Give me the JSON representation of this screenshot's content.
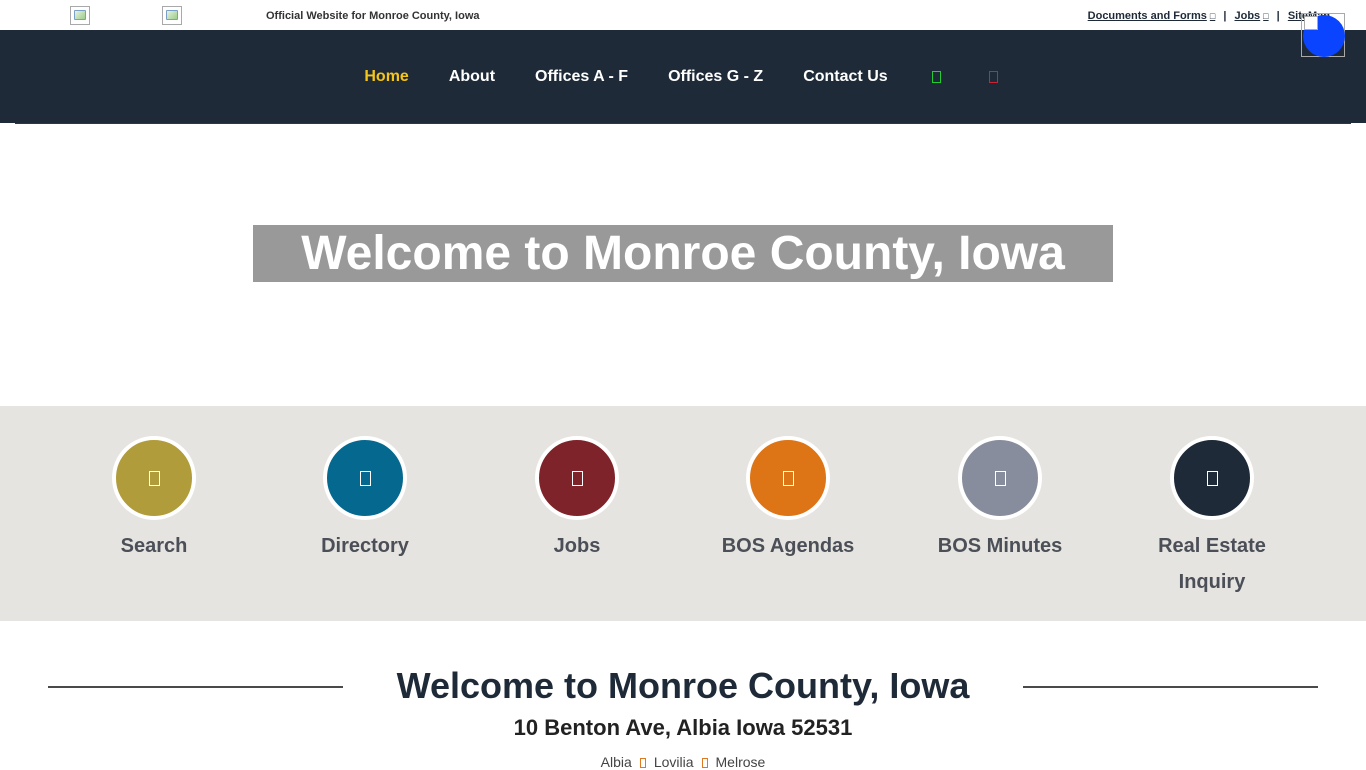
{
  "topbar": {
    "tagline": "Official Website for Monroe County, Iowa",
    "links": [
      {
        "label": "Documents and Forms"
      },
      {
        "label": "Jobs"
      },
      {
        "label": "SiteMap"
      }
    ],
    "separator": "|"
  },
  "nav": {
    "items": [
      {
        "label": "Home",
        "active": true
      },
      {
        "label": "About"
      },
      {
        "label": "Offices A - F"
      },
      {
        "label": "Offices G - Z"
      },
      {
        "label": "Contact Us"
      }
    ],
    "icons": [
      "green-square-icon",
      "red-square-icon"
    ]
  },
  "hero": {
    "title": "Welcome to Monroe County, Iowa"
  },
  "quick_links": [
    {
      "label": "Search",
      "color": "#b09c3a",
      "icon": "search-icon"
    },
    {
      "label": "Directory",
      "color": "#05688e",
      "icon": "directory-icon"
    },
    {
      "label": "Jobs",
      "color": "#7d2329",
      "icon": "jobs-icon"
    },
    {
      "label": "BOS Agendas",
      "color": "#dd7416",
      "icon": "agenda-icon"
    },
    {
      "label": "BOS Minutes",
      "color": "#878d9c",
      "icon": "minutes-icon"
    },
    {
      "label": "Real Estate Inquiry",
      "color": "#1e2a38",
      "icon": "real-estate-icon"
    }
  ],
  "footer_intro": {
    "title": "Welcome to Monroe County, Iowa",
    "address": "10 Benton Ave, Albia Iowa 52531",
    "towns": [
      "Albia",
      "Lovilia",
      "Melrose"
    ]
  },
  "colors": {
    "nav_bg": "#1e2a38",
    "nav_active": "#f5c518",
    "band_bg": "#e6e4e0",
    "hero_title_bg": "#999999",
    "fab": "#0a44ff"
  }
}
